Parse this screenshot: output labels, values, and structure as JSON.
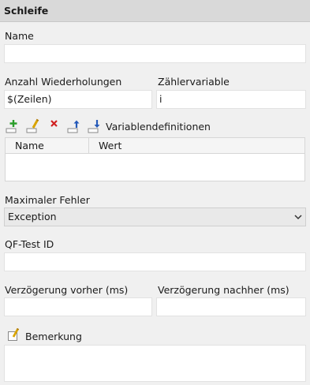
{
  "panel": {
    "title": "Schleife"
  },
  "name": {
    "label": "Name",
    "value": ""
  },
  "repetitions": {
    "label": "Anzahl Wiederholungen",
    "value": "$(Zeilen)"
  },
  "counter": {
    "label": "Zählervariable",
    "value": "i"
  },
  "variables": {
    "label": "Variablendefinitionen",
    "toolbar_icons": [
      "add-icon",
      "edit-icon",
      "delete-icon",
      "move-up-icon",
      "move-down-icon"
    ],
    "columns": [
      "Name",
      "Wert"
    ],
    "rows": []
  },
  "max_error": {
    "label": "Maximaler Fehler",
    "selected": "Exception"
  },
  "qftest_id": {
    "label": "QF-Test ID",
    "value": ""
  },
  "delay_before": {
    "label": "Verzögerung vorher (ms)",
    "value": ""
  },
  "delay_after": {
    "label": "Verzögerung nachher (ms)",
    "value": ""
  },
  "comment": {
    "label": "Bemerkung",
    "value": ""
  }
}
